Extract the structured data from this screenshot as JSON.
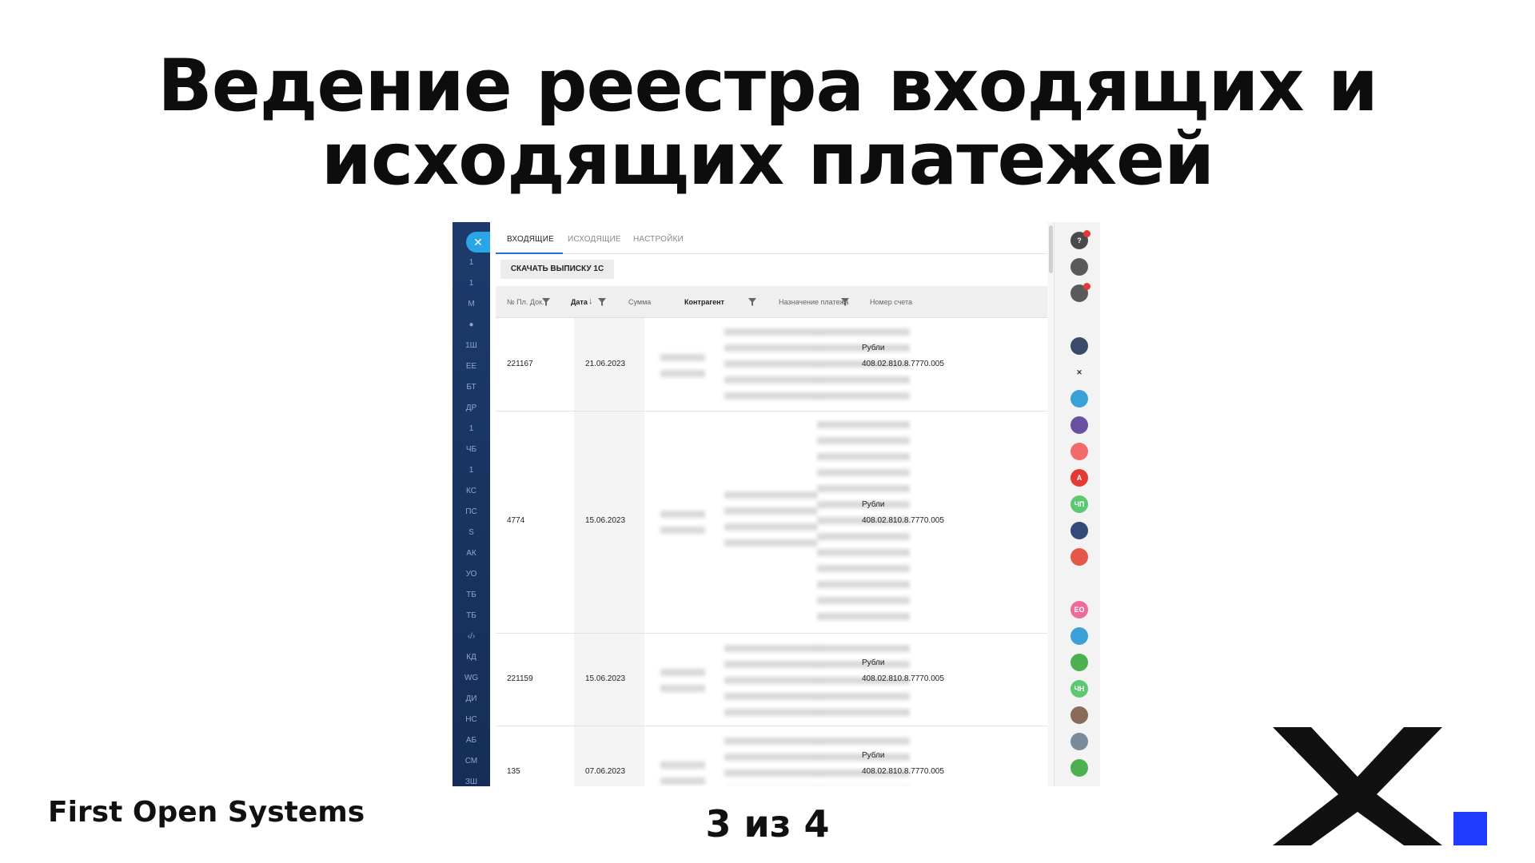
{
  "slide": {
    "title_line1": "Ведение реестра входящих и",
    "title_line2": "исходящих платежей",
    "company": "First Open Systems",
    "page": "3 из 4"
  },
  "app": {
    "left_rail": [
      "1",
      "1",
      "М",
      "",
      "1Ш",
      "ЕЕ",
      "БТ",
      "ДР",
      "1",
      "ЧБ",
      "1",
      "КС",
      "ПС",
      "S",
      "АК",
      "УО",
      "ТБ",
      "ТБ",
      "",
      "КД",
      "WG",
      "ДИ",
      "НС",
      "АБ",
      "СМ",
      "ЗШ"
    ],
    "tabs": [
      "ВХОДЯЩИЕ",
      "ИСХОДЯЩИЕ",
      "НАСТРОЙКИ"
    ],
    "active_tab": "ВХОДЯЩИЕ",
    "download_button": "СКАЧАТЬ ВЫПИСКУ 1С",
    "table": {
      "columns": [
        "№ Пл. Док.",
        "Дата",
        "Сумма",
        "Контрагент",
        "Назначение платежа",
        "Номер счета"
      ],
      "rows": [
        {
          "doc": "221167",
          "date": "21.06.2023",
          "currency": "Рубли",
          "account": "408.02.810.8.7770.005"
        },
        {
          "doc": "4774",
          "date": "15.06.2023",
          "currency": "Рубли",
          "account": "408.02.810.8.7770.005"
        },
        {
          "doc": "221159",
          "date": "15.06.2023",
          "currency": "Рубли",
          "account": "408.02.810.8.7770.005"
        },
        {
          "doc": "135",
          "date": "07.06.2023",
          "currency": "Рубли",
          "account": "408.02.810.8.7770.005"
        }
      ]
    },
    "right_rail": [
      {
        "name": "help-icon",
        "color": "#4a4a4a",
        "label": "?"
      },
      {
        "name": "bell-icon",
        "color": "#5a5a5a",
        "label": ""
      },
      {
        "name": "chat-icon",
        "color": "#5a5a5a",
        "label": ""
      },
      {
        "name": "search-icon",
        "color": "#f3f3f3",
        "label": ""
      },
      {
        "name": "pattern-icon",
        "color": "#3b4a6b",
        "label": ""
      },
      {
        "name": "x-logo-icon",
        "color": "#f3f3f3",
        "label": "✕"
      },
      {
        "name": "phone-icon",
        "color": "#3aa0d8",
        "label": ""
      },
      {
        "name": "shell-icon",
        "color": "#6b4fa0",
        "label": ""
      },
      {
        "name": "toggle-icon",
        "color": "#f26b6b",
        "label": ""
      },
      {
        "name": "a-icon",
        "color": "#e53935",
        "label": "А"
      },
      {
        "name": "avatar-chp",
        "color": "#5cc86f",
        "label": "ЧП"
      },
      {
        "name": "app-icon-1",
        "color": "#344a7a",
        "label": ""
      },
      {
        "name": "people-icon",
        "color": "#e4584a",
        "label": ""
      },
      {
        "name": "app-icon-2",
        "color": "#f3f3f3",
        "label": ""
      },
      {
        "name": "avatar-eo",
        "color": "#ec6b9a",
        "label": "ЕО"
      },
      {
        "name": "video-icon",
        "color": "#3aa0d8",
        "label": ""
      },
      {
        "name": "app-icon-3",
        "color": "#4caf50",
        "label": ""
      },
      {
        "name": "avatar-chn",
        "color": "#5cc86f",
        "label": "ЧН"
      },
      {
        "name": "avatar-photo-1",
        "color": "#8a6a5a",
        "label": ""
      },
      {
        "name": "avatar-photo-2",
        "color": "#7a8a9a",
        "label": ""
      },
      {
        "name": "app-icon-4",
        "color": "#4caf50",
        "label": ""
      }
    ]
  },
  "colors": {
    "rail": "#1d3a6c",
    "accent": "#2aa6e8",
    "logo_square": "#1f3bff"
  }
}
